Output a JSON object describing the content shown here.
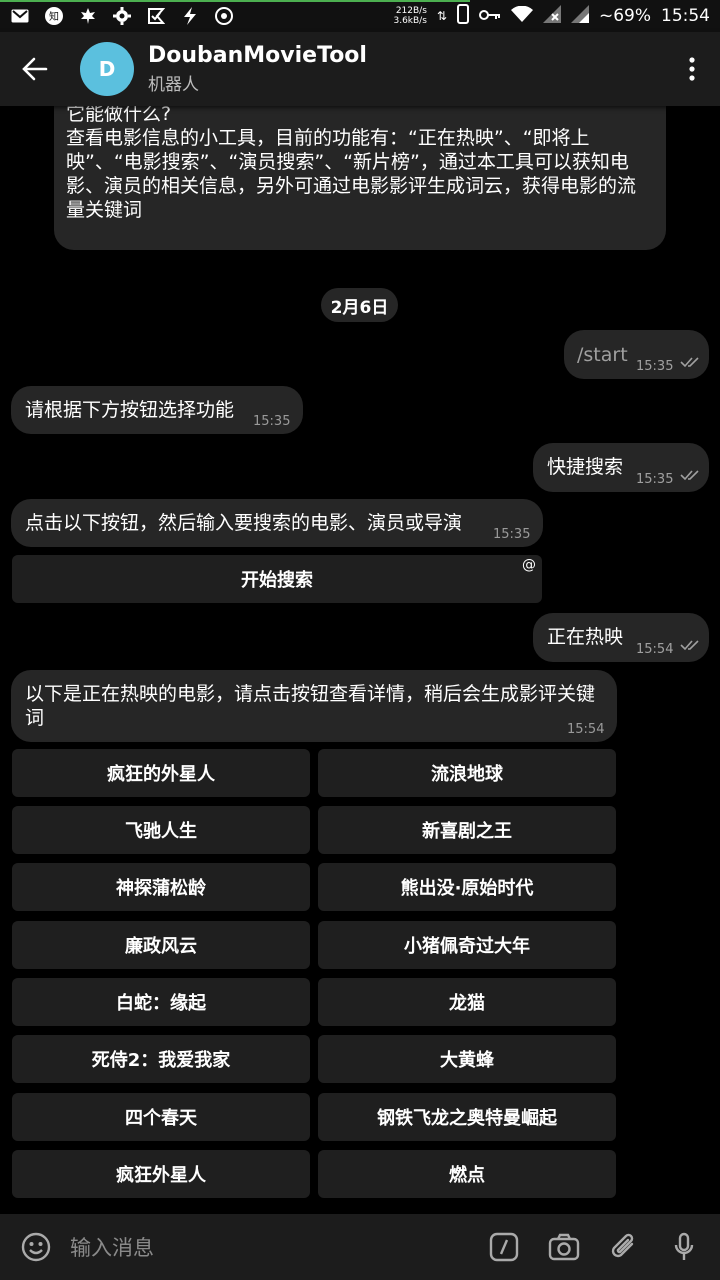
{
  "status_bar": {
    "speed_up": "212B/s",
    "speed_down": "3.6kB/s",
    "battery": "~69%",
    "time": "15:54"
  },
  "header": {
    "avatar_letter": "D",
    "title": "DoubanMovieTool",
    "subtitle": "机器人"
  },
  "intro": {
    "heading": "它能做什么?",
    "body": "查看电影信息的小工具，目前的功能有：“正在热映”、“即将上映”、“电影搜索”、“演员搜索”、“新片榜”，通过本工具可以获知电影、演员的相关信息，另外可通过电影影评生成词云，获得电影的流量关键词"
  },
  "date_chip": "2月6日",
  "messages": {
    "m1": {
      "text": "/start",
      "time": "15:35"
    },
    "m2": {
      "text": "请根据下方按钮选择功能",
      "time": "15:35"
    },
    "m3": {
      "text": "快捷搜索",
      "time": "15:35"
    },
    "m4": {
      "text": "点击以下按钮，然后输入要搜索的电影、演员或导演",
      "time": "15:35"
    },
    "m4_button": "开始搜索",
    "m4_button_badge": "@",
    "m5": {
      "text": "正在热映",
      "time": "15:54"
    },
    "m6": {
      "text": "以下是正在热映的电影，请点击按钮查看详情，稍后会生成影评关键词",
      "time": "15:54"
    }
  },
  "movie_buttons": [
    "疯狂的外星人",
    "流浪地球",
    "飞驰人生",
    "新喜剧之王",
    "神探蒲松龄",
    "熊出没·原始时代",
    "廉政风云",
    "小猪佩奇过大年",
    "白蛇：缘起",
    "龙猫",
    "死侍2：我爱我家",
    "大黄蜂",
    "四个春天",
    "钢铁飞龙之奥特曼崛起",
    "疯狂外星人",
    "燃点"
  ],
  "input": {
    "placeholder": "输入消息"
  }
}
